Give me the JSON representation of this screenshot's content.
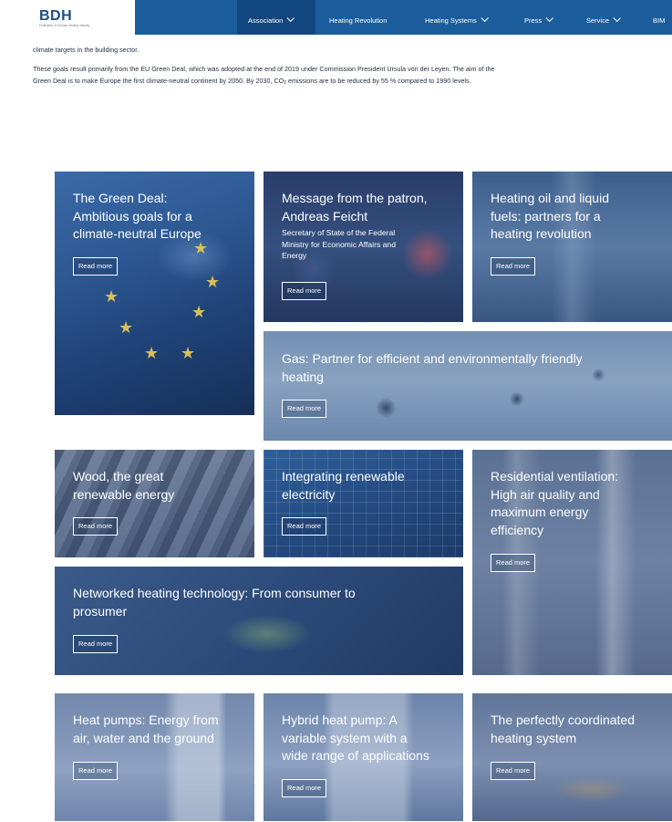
{
  "header": {
    "logo": "BDH",
    "logo_sub": "Federation of German Heating Industry",
    "nav": [
      {
        "label": "Association",
        "chevron": true,
        "active": true
      },
      {
        "label": "Heating Revolution",
        "chevron": false,
        "active": false
      },
      {
        "label": "Heating Systems",
        "chevron": true,
        "active": false
      },
      {
        "label": "Press",
        "chevron": true,
        "active": false
      },
      {
        "label": "Service",
        "chevron": true,
        "active": false
      },
      {
        "label": "BIM",
        "chevron": false,
        "active": false
      }
    ]
  },
  "intro": {
    "line1": "climate targets in the building sector.",
    "line2": "These goals result primarily from the EU Green Deal, which was adopted at the end of 2019 under Commission President Ursula von der Leyen. The aim of the",
    "line3_a": "Green Deal is to make Europe the first climate-neutral continent by 2050. By 2030, CO",
    "line3_sub": "2",
    "line3_b": " emissions are to be reduced by 55 % compared to 1990 levels."
  },
  "tiles": {
    "read_more": "Read more",
    "green_deal": {
      "lines": [
        "The Green Deal:",
        "Ambitious goals for a",
        "climate-neutral Europe"
      ]
    },
    "patron": {
      "lines": [
        "Message from the patron,",
        "Andreas Feicht"
      ],
      "sub": [
        "Secretary of State of the Federal",
        "Ministry for Economic Affairs and",
        "Energy"
      ]
    },
    "oil": {
      "lines": [
        "Heating oil and liquid",
        "fuels: partners for a",
        "heating revolution"
      ]
    },
    "gas": {
      "lines": [
        "Gas: Partner for efficient and environmentally friendly",
        "heating"
      ]
    },
    "wood": {
      "lines": [
        "Wood, the great",
        "renewable energy"
      ]
    },
    "renewable": {
      "lines": [
        "Integrating renewable",
        "electricity"
      ]
    },
    "ventilation": {
      "lines": [
        "Residential ventilation:",
        "High air quality and",
        "maximum energy",
        "efficiency"
      ]
    },
    "networked": {
      "lines": [
        "Networked heating technology: From consumer to",
        "prosumer"
      ]
    },
    "heat_pumps": {
      "lines": [
        "Heat pumps: Energy from",
        "air, water and the ground"
      ]
    },
    "hybrid": {
      "lines": [
        "Hybrid heat pump: A",
        "variable system with a",
        "wide range of applications"
      ]
    },
    "coordinated": {
      "lines": [
        "The perfectly coordinated",
        "heating system"
      ]
    }
  }
}
